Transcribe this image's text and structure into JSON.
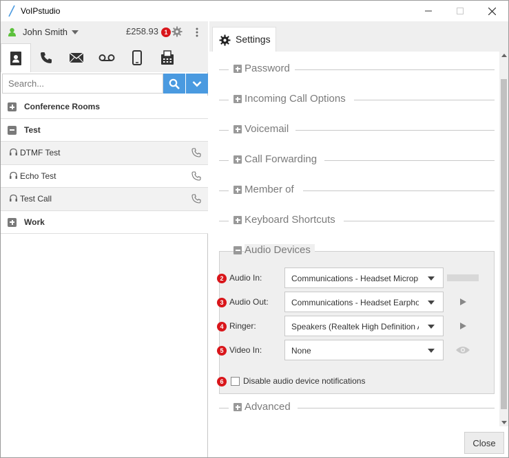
{
  "window": {
    "title": "VoIPstudio"
  },
  "user": {
    "name": "John Smith",
    "balance": "£258.93",
    "presence_color": "#5cc13c"
  },
  "badges": [
    "1",
    "2",
    "3",
    "4",
    "5",
    "6"
  ],
  "icons": {
    "tabs": [
      "contacts-icon",
      "phone-icon",
      "envelope-icon",
      "voicemail-icon",
      "mobile-icon",
      "fax-icon"
    ]
  },
  "search": {
    "placeholder": "Search..."
  },
  "contacts": {
    "groups": [
      {
        "label": "Conference Rooms"
      },
      {
        "label": "Test"
      },
      {
        "label": "Work"
      }
    ],
    "items": [
      {
        "label": "DTMF Test"
      },
      {
        "label": "Echo Test"
      },
      {
        "label": "Test Call"
      }
    ]
  },
  "settings": {
    "tab_label": "Settings",
    "sections": [
      "Password",
      "Incoming Call Options",
      "Voicemail",
      "Call Forwarding",
      "Member of",
      "Keyboard Shortcuts",
      "Audio Devices",
      "Advanced"
    ],
    "audio": {
      "rows": [
        {
          "label": "Audio In:",
          "value": "Communications - Headset Microphone"
        },
        {
          "label": "Audio Out:",
          "value": "Communications - Headset Earphone"
        },
        {
          "label": "Ringer:",
          "value": "Speakers (Realtek High Definition Audio)"
        },
        {
          "label": "Video In:",
          "value": "None"
        }
      ],
      "notifications_label": "Disable audio device notifications",
      "notifications_checked": false
    },
    "close_label": "Close"
  },
  "colors": {
    "accent": "#4a9ae0",
    "badge": "#d9161b"
  }
}
